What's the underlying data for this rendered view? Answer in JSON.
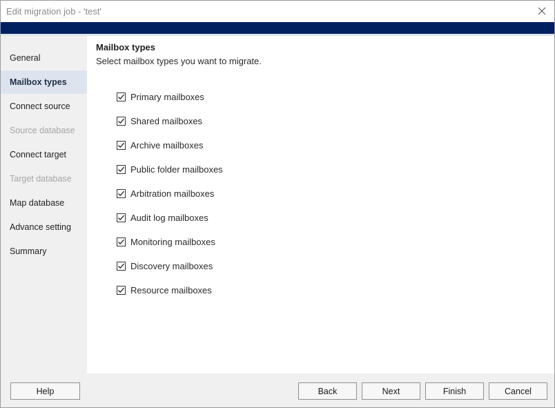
{
  "window": {
    "title": "Edit migration job - 'test'"
  },
  "sidebar": {
    "items": [
      {
        "label": "General",
        "state": "normal"
      },
      {
        "label": "Mailbox types",
        "state": "active"
      },
      {
        "label": "Connect source",
        "state": "normal"
      },
      {
        "label": "Source database",
        "state": "disabled"
      },
      {
        "label": "Connect target",
        "state": "normal"
      },
      {
        "label": "Target database",
        "state": "disabled"
      },
      {
        "label": "Map database",
        "state": "normal"
      },
      {
        "label": "Advance setting",
        "state": "normal"
      },
      {
        "label": "Summary",
        "state": "normal"
      }
    ]
  },
  "main": {
    "title": "Mailbox types",
    "subtitle": "Select mailbox types you want to migrate.",
    "options": [
      {
        "label": "Primary mailboxes",
        "checked": true
      },
      {
        "label": "Shared mailboxes",
        "checked": true
      },
      {
        "label": "Archive mailboxes",
        "checked": true
      },
      {
        "label": "Public folder mailboxes",
        "checked": true
      },
      {
        "label": "Arbitration mailboxes",
        "checked": true
      },
      {
        "label": "Audit log mailboxes",
        "checked": true
      },
      {
        "label": "Monitoring mailboxes",
        "checked": true
      },
      {
        "label": "Discovery mailboxes",
        "checked": true
      },
      {
        "label": "Resource mailboxes",
        "checked": true
      }
    ]
  },
  "footer": {
    "help": "Help",
    "back": "Back",
    "next": "Next",
    "finish": "Finish",
    "cancel": "Cancel"
  },
  "colors": {
    "banner": "#002060",
    "active_nav_bg": "#dde4f0",
    "disabled_text": "#a6a6a6"
  },
  "icons": {
    "close": "close-icon",
    "check": "checkmark-icon"
  }
}
